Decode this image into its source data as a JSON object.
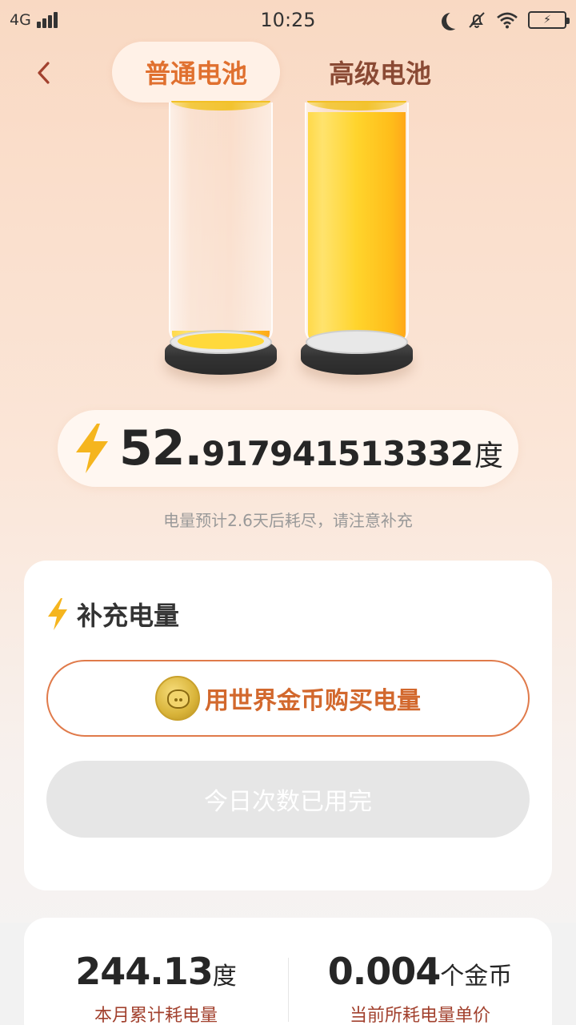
{
  "status_bar": {
    "network": "4G",
    "time": "10:25"
  },
  "tabs": [
    {
      "label": "普通电池",
      "active": true
    },
    {
      "label": "高级电池",
      "active": false
    }
  ],
  "batteries": [
    {
      "name": "普通电池",
      "fill_level": 0.05
    },
    {
      "name": "高级电池",
      "fill_level": 0.98
    }
  ],
  "power": {
    "integer": "52.",
    "decimal": "917941513332",
    "unit": "度"
  },
  "hint": "电量预计2.6天后耗尽，请注意补充",
  "recharge": {
    "title": "补充电量",
    "buy_button": "用世界金币购买电量",
    "used_button": "今日次数已用完"
  },
  "stats": [
    {
      "value": "244.13",
      "unit": "度",
      "label": "本月累计耗电量"
    },
    {
      "value": "0.004",
      "unit": "个金币",
      "label": "当前所耗电量单价"
    }
  ],
  "colors": {
    "accent": "#e0702f",
    "bolt": "#f5b51e",
    "battery_fill": "#ffc928"
  }
}
